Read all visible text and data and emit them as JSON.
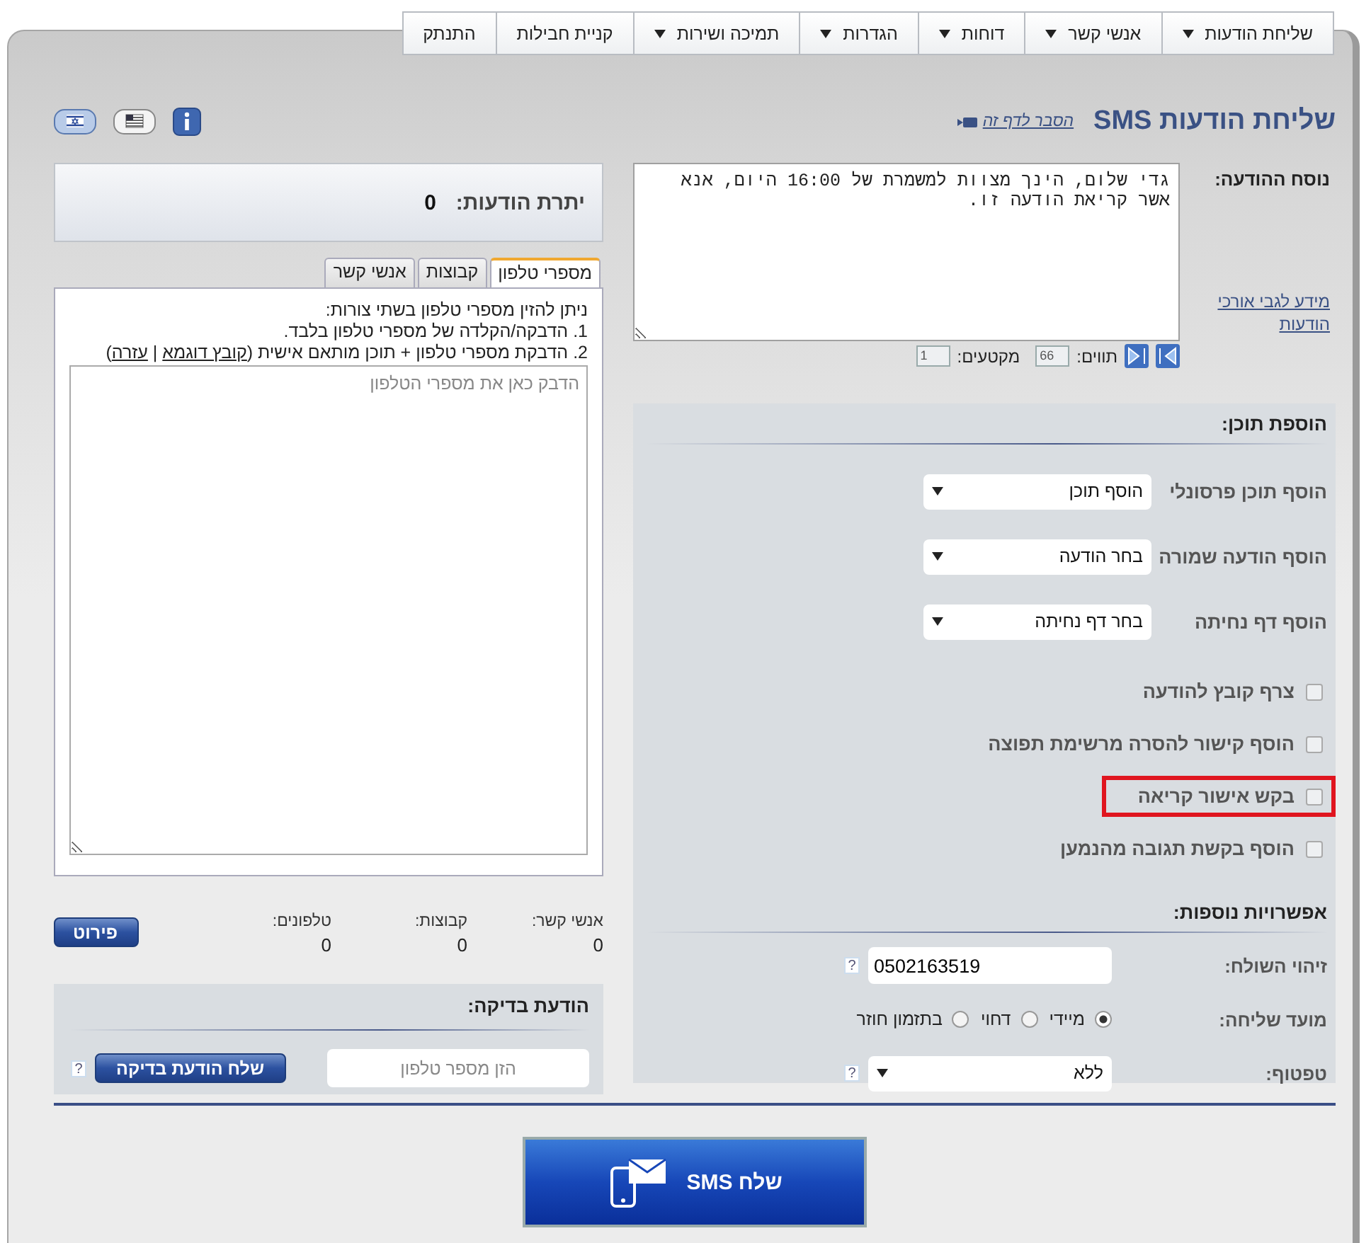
{
  "nav": [
    {
      "label": "שליחת הודעות",
      "dropdown": true
    },
    {
      "label": "אנשי קשר",
      "dropdown": true
    },
    {
      "label": "דוחות",
      "dropdown": true
    },
    {
      "label": "הגדרות",
      "dropdown": true
    },
    {
      "label": "תמיכה ושירות",
      "dropdown": true
    },
    {
      "label": "קניית חבילות",
      "dropdown": false
    },
    {
      "label": "התנתק",
      "dropdown": false
    }
  ],
  "title": "שליחת הודעות SMS",
  "help_link": "הסבר לדף זה",
  "message": {
    "label": "נוסח ההודעה:",
    "text": "גדי שלום, הינך מצוות למשמרת של 16:00 היום, אנא אשר קריאת הודעה זו.",
    "info_link": "מידע לגבי אורכי הודעות",
    "chars_label": "תווים:",
    "chars": "66",
    "segments_label": "מקטעים:",
    "segments": "1"
  },
  "add_content": {
    "title": "הוספת תוכן:",
    "selects": [
      {
        "label": "הוסף תוכן פרסונלי",
        "value": "הוסף תוכן"
      },
      {
        "label": "הוסף הודעה שמורה",
        "value": "בחר הודעה"
      },
      {
        "label": "הוסף דף נחיתה",
        "value": "בחר דף נחיתה"
      }
    ],
    "checkboxes": [
      {
        "label": "צרף קובץ להודעה",
        "checked": false,
        "highlighted": false
      },
      {
        "label": "הוסף קישור להסרה מרשימת תפוצה",
        "checked": false,
        "highlighted": false
      },
      {
        "label": "בקש אישור קריאה",
        "checked": false,
        "highlighted": true
      },
      {
        "label": "הוסף בקשת תגובה מהנמען",
        "checked": false,
        "highlighted": false
      }
    ]
  },
  "more_options": {
    "title": "אפשרויות נוספות:",
    "sender": {
      "label": "זיהוי השולח:",
      "value": "0502163519",
      "help": "?"
    },
    "timing": {
      "label": "מועד שליחה:",
      "options": [
        {
          "label": "מיידי",
          "selected": true
        },
        {
          "label": "דחוי",
          "selected": false
        },
        {
          "label": "בתזמון חוזר",
          "selected": false
        }
      ]
    },
    "drip": {
      "label": "טפטוף:",
      "value": "ללא",
      "help": "?"
    }
  },
  "balance": {
    "label": "יתרת הודעות:",
    "value": "0"
  },
  "tabs": [
    {
      "label": "מספרי טלפון",
      "selected": true
    },
    {
      "label": "קבוצות",
      "selected": false
    },
    {
      "label": "אנשי קשר",
      "selected": false
    }
  ],
  "phone_tab": {
    "lines": [
      "ניתן להזין מספרי טלפון בשתי צורות:",
      "1. הדבקה/הקלדה של מספרי טלפון בלבד."
    ],
    "line_parts": [
      {
        "kind": "text",
        "text": "2. הדבקת מספרי טלפון + תוכן מותאם אישית ("
      },
      {
        "kind": "link",
        "text": "קובץ דוגמא"
      },
      {
        "kind": "text",
        "text": " | "
      },
      {
        "kind": "link",
        "text": "עזרה"
      },
      {
        "kind": "text",
        "text": ")"
      }
    ],
    "placeholder": "הדבק כאן את מספרי הטלפון"
  },
  "counts": [
    {
      "label": "אנשי קשר:",
      "value": "0"
    },
    {
      "label": "קבוצות:",
      "value": "0"
    },
    {
      "label": "טלפונים:",
      "value": "0"
    }
  ],
  "details_button": "פירוט",
  "test": {
    "title": "הודעת בדיקה:",
    "placeholder": "הזן מספר טלפון",
    "button": "שלח הודעת בדיקה",
    "help": "?"
  },
  "send_button": "שלח SMS"
}
